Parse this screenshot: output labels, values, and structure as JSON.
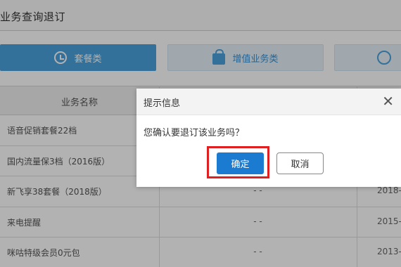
{
  "header": {
    "title": "业务查询退订"
  },
  "tabs": [
    {
      "label": "套餐类",
      "icon": "clock-icon"
    },
    {
      "label": "增值业务类",
      "icon": "bag-icon"
    },
    {
      "label": "",
      "icon": "headset-icon"
    }
  ],
  "table": {
    "columns": [
      "业务名称"
    ],
    "rows": [
      {
        "name": "语音促销套餐22档",
        "mid": "",
        "date": ""
      },
      {
        "name": "国内流量保3档（2016版）",
        "mid": "",
        "date": ""
      },
      {
        "name": "新飞享38套餐（2018版）",
        "mid": "- -",
        "date": "2018-0"
      },
      {
        "name": "来电提醒",
        "mid": "- -",
        "date": "2015-0"
      },
      {
        "name": "咪咕特级会员0元包",
        "mid": "- -",
        "date": "2013-1"
      }
    ]
  },
  "dialog": {
    "title": "提示信息",
    "close": "✕",
    "message": "您确认要退订该业务吗？",
    "ok_label": "确定",
    "cancel_label": "取消"
  },
  "colors": {
    "accent": "#4aa3df",
    "primary_button": "#1a7bd0",
    "highlight": "#e02020"
  }
}
